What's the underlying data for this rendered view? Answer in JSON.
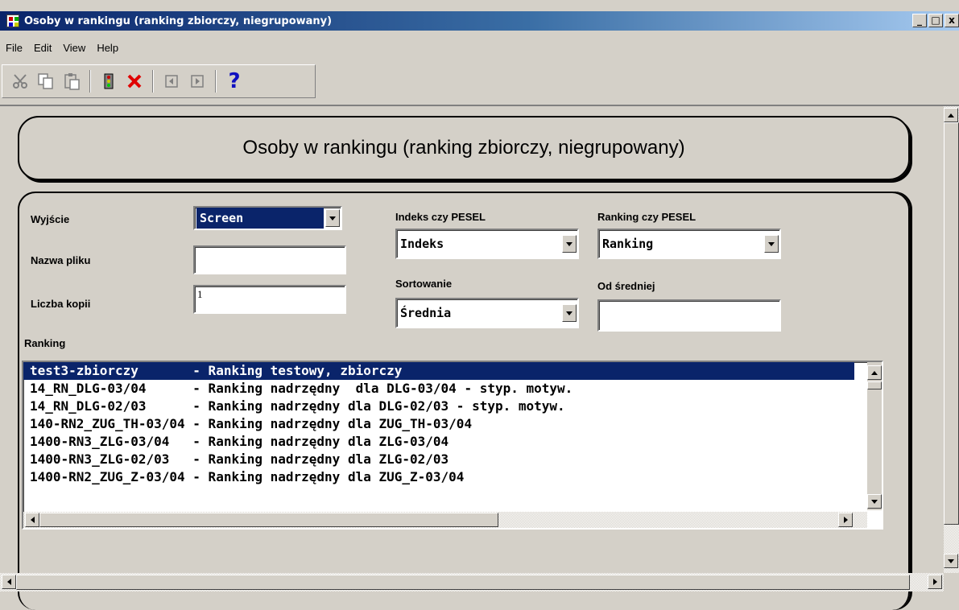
{
  "window": {
    "title": "Osoby w rankingu (ranking zbiorczy, niegrupowany)",
    "minimize": "_",
    "maximize": "□",
    "close": "x"
  },
  "menu": [
    "File",
    "Edit",
    "View",
    "Help"
  ],
  "toolbar": {
    "icons": [
      "cut-icon",
      "copy-icon",
      "paste-icon",
      "traffic-light-icon",
      "delete-icon",
      "prev-icon",
      "next-icon",
      "help-icon"
    ],
    "help_glyph": "?"
  },
  "header": {
    "title": "Osoby w rankingu (ranking zbiorczy, niegrupowany)"
  },
  "form": {
    "output_label": "Wyjście",
    "output_value": "Screen",
    "filename_label": "Nazwa pliku",
    "filename_value": "",
    "copies_label": "Liczba kopii",
    "copies_value": "1",
    "index_pesel_label": "Indeks czy PESEL",
    "index_pesel_value": "Indeks",
    "ranking_pesel_label": "Ranking czy PESEL",
    "ranking_pesel_value": "Ranking",
    "sort_label": "Sortowanie",
    "sort_value": "Średnia",
    "from_avg_label": "Od średniej",
    "from_avg_value": "",
    "ranking_label": "Ranking"
  },
  "ranking_list": {
    "selected_index": 0,
    "rows": [
      "test3-zbiorczy       - Ranking testowy, zbiorczy",
      "14_RN_DLG-03/04      - Ranking nadrzędny  dla DLG-03/04 - styp. motyw.",
      "14_RN_DLG-02/03      - Ranking nadrzędny dla DLG-02/03 - styp. motyw.",
      "140-RN2_ZUG_TH-03/04 - Ranking nadrzędny dla ZUG_TH-03/04",
      "1400-RN3_ZLG-03/04   - Ranking nadrzędny dla ZLG-03/04",
      "1400-RN3_ZLG-02/03   - Ranking nadrzędny dla ZLG-02/03",
      "1400-RN2_ZUG_Z-03/04 - Ranking nadrzędny dla ZUG_Z-03/04"
    ]
  },
  "colors": {
    "face": "#d4d0c8",
    "selection": "#0a246a",
    "title_start": "#0a246a"
  }
}
